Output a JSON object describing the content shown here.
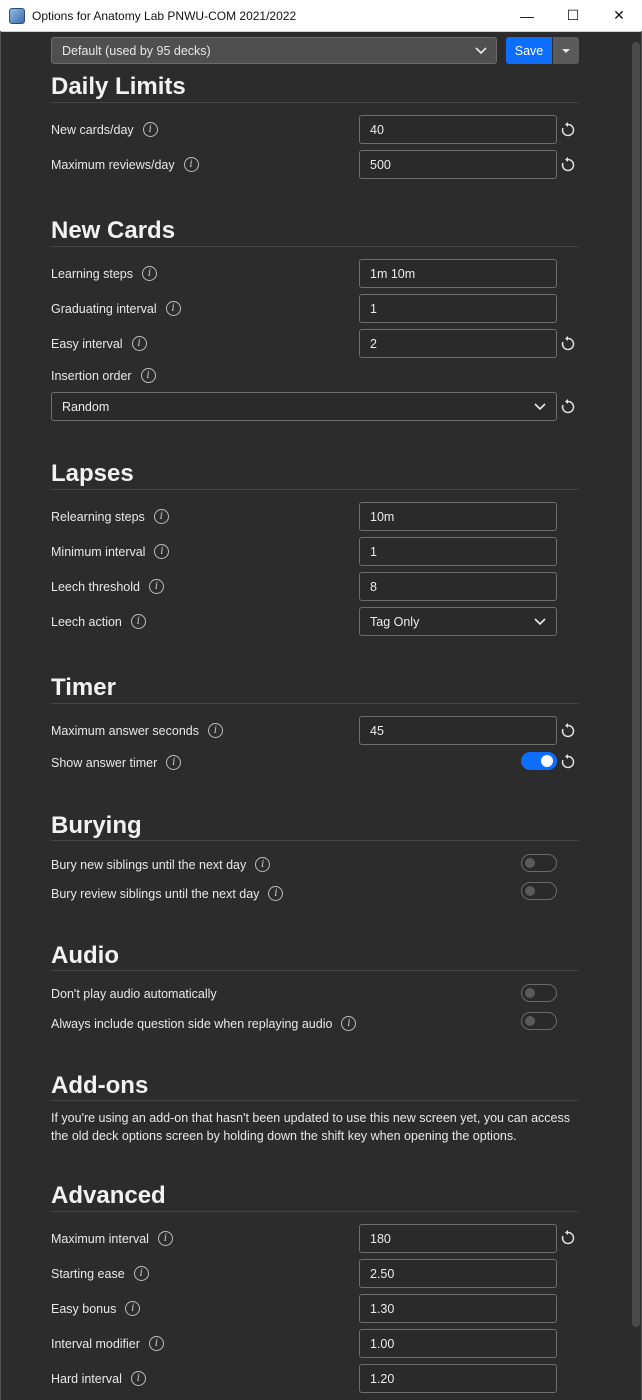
{
  "window": {
    "title": "Options for Anatomy Lab PNWU-COM 2021/2022",
    "minimize": "—",
    "maximize": "☐",
    "close": "✕"
  },
  "header": {
    "preset_value": "Default (used by 95 decks)",
    "save_label": "Save"
  },
  "sections": {
    "daily_limits": {
      "title": "Daily Limits",
      "new_cards_label": "New cards/day",
      "new_cards_value": "40",
      "max_reviews_label": "Maximum reviews/day",
      "max_reviews_value": "500"
    },
    "new_cards": {
      "title": "New Cards",
      "learning_steps_label": "Learning steps",
      "learning_steps_value": "1m 10m",
      "graduating_label": "Graduating interval",
      "graduating_value": "1",
      "easy_label": "Easy interval",
      "easy_value": "2",
      "insertion_label": "Insertion order",
      "insertion_value": "Random"
    },
    "lapses": {
      "title": "Lapses",
      "relearning_label": "Relearning steps",
      "relearning_value": "10m",
      "min_interval_label": "Minimum interval",
      "min_interval_value": "1",
      "leech_threshold_label": "Leech threshold",
      "leech_threshold_value": "8",
      "leech_action_label": "Leech action",
      "leech_action_value": "Tag Only"
    },
    "timer": {
      "title": "Timer",
      "max_answer_label": "Maximum answer seconds",
      "max_answer_value": "45",
      "show_timer_label": "Show answer timer",
      "show_timer_on": true
    },
    "burying": {
      "title": "Burying",
      "bury_new_label": "Bury new siblings until the next day",
      "bury_new_on": false,
      "bury_review_label": "Bury review siblings until the next day",
      "bury_review_on": false
    },
    "audio": {
      "title": "Audio",
      "no_autoplay_label": "Don't play audio automatically",
      "no_autoplay_on": false,
      "include_question_label": "Always include question side when replaying audio",
      "include_question_on": false
    },
    "addons": {
      "title": "Add-ons",
      "text": "If you're using an add-on that hasn't been updated to use this new screen yet, you can access the old deck options screen by holding down the shift key when opening the options."
    },
    "advanced": {
      "title": "Advanced",
      "max_interval_label": "Maximum interval",
      "max_interval_value": "180",
      "starting_ease_label": "Starting ease",
      "starting_ease_value": "2.50",
      "easy_bonus_label": "Easy bonus",
      "easy_bonus_value": "1.30",
      "interval_modifier_label": "Interval modifier",
      "interval_modifier_value": "1.00",
      "hard_interval_label": "Hard interval",
      "hard_interval_value": "1.20"
    }
  },
  "icons": {
    "info": "i",
    "colors": {
      "accent": "#0d6efd",
      "background": "#2c2c2c",
      "field_border": "#6e6e6e"
    }
  }
}
